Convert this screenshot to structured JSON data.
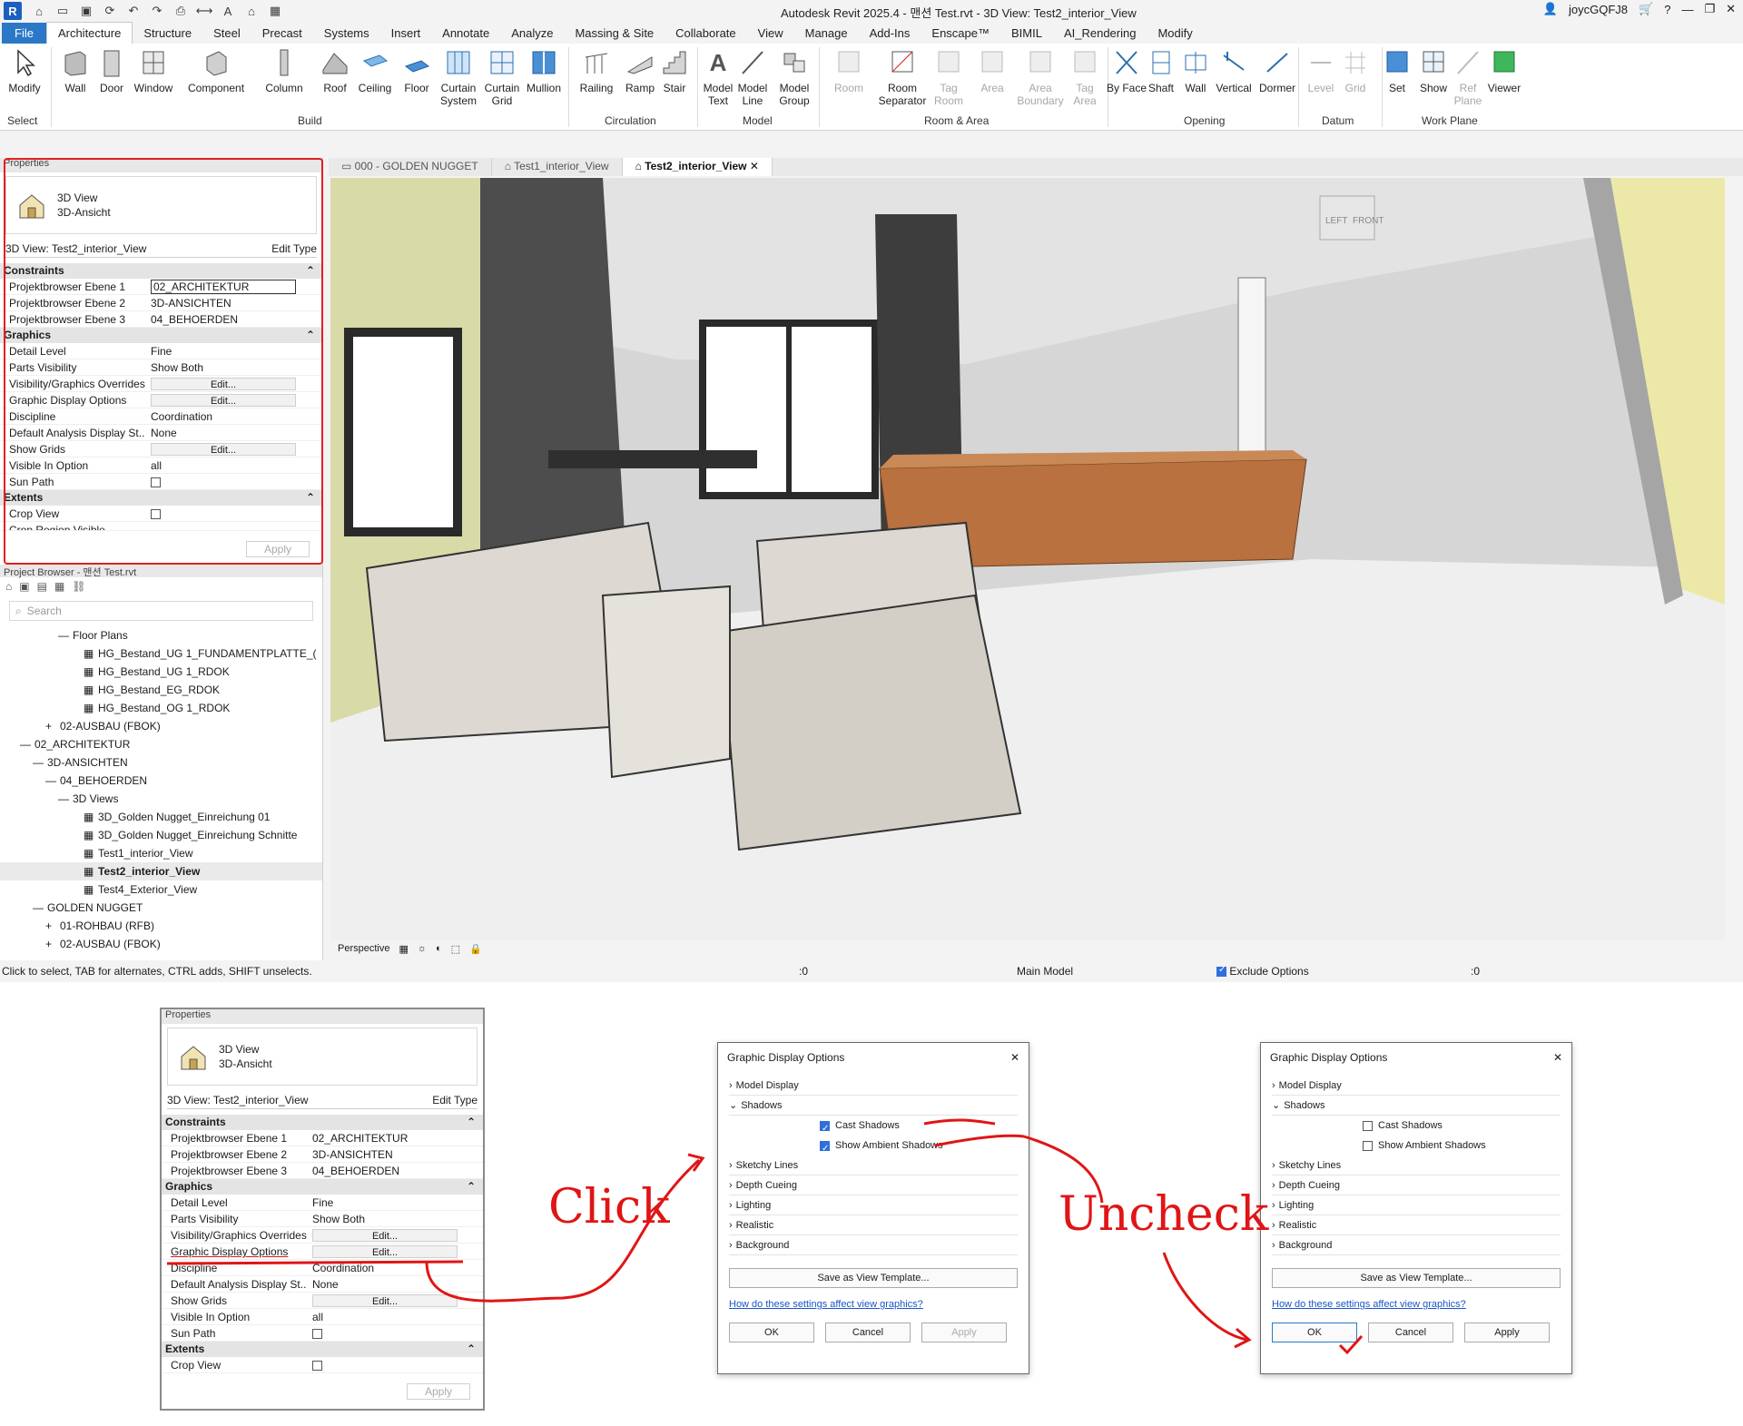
{
  "app": {
    "logo": "R",
    "title": "Autodesk Revit 2025.4 - 맨션 Test.rvt - 3D View: Test2_interior_View",
    "user": "joycGQFJ8",
    "help": "?"
  },
  "tabs": [
    "File",
    "Architecture",
    "Structure",
    "Steel",
    "Precast",
    "Systems",
    "Insert",
    "Annotate",
    "Analyze",
    "Massing & Site",
    "Collaborate",
    "View",
    "Manage",
    "Add-Ins",
    "Enscape™",
    "BIMIL",
    "AI_Rendering",
    "Modify"
  ],
  "ribbon": {
    "modify": "Modify",
    "build": [
      "Wall",
      "Door",
      "Window",
      "Component",
      "Column",
      "Roof",
      "Ceiling",
      "Floor",
      "Curtain System",
      "Curtain Grid",
      "Mullion"
    ],
    "circulation": [
      "Railing",
      "Ramp",
      "Stair"
    ],
    "model": [
      "Model Text",
      "Model Line",
      "Model Group"
    ],
    "room_area": [
      "Room",
      "Room Separator",
      "Tag Room",
      "Area",
      "Area Boundary",
      "Tag Area"
    ],
    "opening": [
      "By Face",
      "Shaft",
      "Wall",
      "Vertical",
      "Dormer"
    ],
    "datum": [
      "Level",
      "Grid"
    ],
    "work_plane": [
      "Set",
      "Show",
      "Ref Plane",
      "Viewer"
    ],
    "panels": [
      "Select",
      "Build",
      "Circulation",
      "Model",
      "Room & Area",
      "Opening",
      "Datum",
      "Work Plane"
    ]
  },
  "properties": {
    "header": "Properties",
    "type_line1": "3D View",
    "type_line2": "3D-Ansicht",
    "selector": "3D View: Test2_interior_View",
    "edit_type": "Edit Type",
    "groups": {
      "constraints": "Constraints",
      "graphics": "Graphics",
      "extents": "Extents"
    },
    "rows": {
      "pb1_k": "Projektbrowser Ebene 1",
      "pb1_v": "02_ARCHITEKTUR",
      "pb2_k": "Projektbrowser Ebene 2",
      "pb2_v": "3D-ANSICHTEN",
      "pb3_k": "Projektbrowser Ebene 3",
      "pb3_v": "04_BEHOERDEN",
      "detail_k": "Detail Level",
      "detail_v": "Fine",
      "parts_k": "Parts Visibility",
      "parts_v": "Show Both",
      "vg_k": "Visibility/Graphics Overrides",
      "gdo_k": "Graphic Display Options",
      "disc_k": "Discipline",
      "disc_v": "Coordination",
      "dads_k": "Default Analysis Display St...",
      "dads_v": "None",
      "grids_k": "Show Grids",
      "vio_k": "Visible In Option",
      "vio_v": "all",
      "sun_k": "Sun Path",
      "crop_k": "Crop View",
      "cropvis_k": "Crop Region Visible"
    },
    "edit_label": "Edit...",
    "apply": "Apply"
  },
  "browser": {
    "header": "Project Browser - 맨션 Test.rvt",
    "search_placeholder": "Search",
    "nodes": [
      {
        "label": "Floor Plans",
        "indent": 4,
        "sign": "—"
      },
      {
        "label": "HG_Bestand_UG 1_FUNDAMENTPLATTE_(",
        "indent": 6,
        "sign": ""
      },
      {
        "label": "HG_Bestand_UG 1_RDOK",
        "indent": 6,
        "sign": ""
      },
      {
        "label": "HG_Bestand_EG_RDOK",
        "indent": 6,
        "sign": ""
      },
      {
        "label": "HG_Bestand_OG 1_RDOK",
        "indent": 6,
        "sign": ""
      },
      {
        "label": "02-AUSBAU (FBOK)",
        "indent": 3,
        "sign": "+"
      },
      {
        "label": "02_ARCHITEKTUR",
        "indent": 1,
        "sign": "—"
      },
      {
        "label": "3D-ANSICHTEN",
        "indent": 2,
        "sign": "—"
      },
      {
        "label": "04_BEHOERDEN",
        "indent": 3,
        "sign": "—"
      },
      {
        "label": "3D Views",
        "indent": 4,
        "sign": "—"
      },
      {
        "label": "3D_Golden Nugget_Einreichung 01",
        "indent": 6,
        "sign": ""
      },
      {
        "label": "3D_Golden Nugget_Einreichung Schnitte",
        "indent": 6,
        "sign": ""
      },
      {
        "label": "Test1_interior_View",
        "indent": 6,
        "sign": ""
      },
      {
        "label": "Test2_interior_View",
        "indent": 6,
        "sign": "",
        "selected": true
      },
      {
        "label": "Test4_Exterior_View",
        "indent": 6,
        "sign": ""
      },
      {
        "label": "GOLDEN NUGGET",
        "indent": 2,
        "sign": "—"
      },
      {
        "label": "01-ROHBAU (RFB)",
        "indent": 3,
        "sign": "+"
      },
      {
        "label": "02-AUSBAU (FBOK)",
        "indent": 3,
        "sign": "+"
      }
    ]
  },
  "view_tabs": [
    "000 - GOLDEN NUGGET",
    "Test1_interior_View",
    "Test2_interior_View"
  ],
  "viewcube": {
    "left": "LEFT",
    "front": "FRONT"
  },
  "view_status": {
    "mode": "Perspective"
  },
  "status_bar": {
    "hint": "Click to select, TAB for alternates, CTRL adds, SHIFT unselects.",
    "zero1": ":0",
    "model": "Main Model",
    "exclude": "Exclude Options",
    "zero2": ":0"
  },
  "dialog": {
    "title": "Graphic Display Options",
    "sections": [
      "Model Display",
      "Shadows",
      "Sketchy Lines",
      "Depth Cueing",
      "Lighting",
      "Realistic",
      "Background"
    ],
    "cast_shadows": "Cast Shadows",
    "ambient_shadows": "Show Ambient Shadows",
    "save_template": "Save as View Template...",
    "help_link": "How do these settings affect view graphics?",
    "ok": "OK",
    "cancel": "Cancel",
    "apply": "Apply"
  },
  "annotations": {
    "click": "Click",
    "uncheck": "Uncheck"
  },
  "colors": {
    "accent": "#2b78c7",
    "annotation_red": "#e01515",
    "cabinet_wood": "#b8713f",
    "wall_green": "#d8dba8"
  }
}
